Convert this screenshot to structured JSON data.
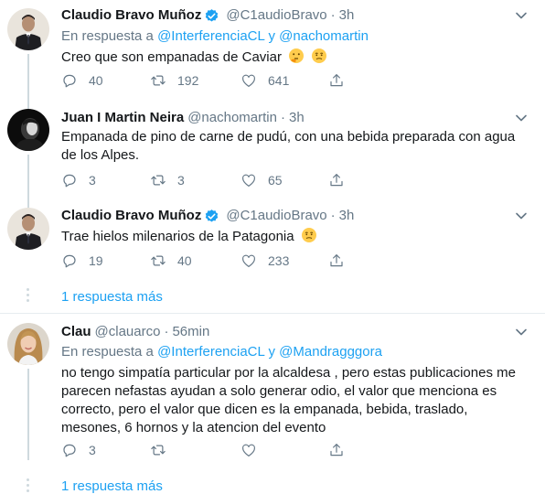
{
  "tweets": [
    {
      "name": "Claudio Bravo Muñoz",
      "verified": true,
      "handle": "@C1audioBravo",
      "time": "3h",
      "reply_prefix": "En respuesta a",
      "reply_to_1": "@InterferenciaCL",
      "reply_and": "y",
      "reply_to_2": "@nachomartin",
      "text": "Creo que son empanadas de Caviar",
      "emojis": [
        "thinking-face-emoji",
        "smirk-face-emoji"
      ],
      "replies": "40",
      "retweets": "192",
      "likes": "641"
    },
    {
      "name": "Juan I Martin Neira",
      "handle": "@nachomartin",
      "time": "3h",
      "text": "Empanada de pino de carne de pudú, con una bebida preparada con agua de los Alpes.",
      "replies": "3",
      "retweets": "3",
      "likes": "65"
    },
    {
      "name": "Claudio Bravo Muñoz",
      "verified": true,
      "handle": "@C1audioBravo",
      "time": "3h",
      "text": "Trae hielos milenarios de la Patagonia",
      "emojis": [
        "smirk-face-emoji"
      ],
      "replies": "19",
      "retweets": "40",
      "likes": "233"
    },
    {
      "name": "Clau",
      "handle": "@clauarco",
      "time": "56min",
      "reply_prefix": "En respuesta a",
      "reply_to_1": "@InterferenciaCL",
      "reply_and": "y",
      "reply_to_2": "@Mandragggora",
      "text": "no tengo simpatía particular por la alcaldesa , pero estas publicaciones me parecen nefastas ayudan a solo generar odio, el valor que menciona es correcto, pero el valor que dicen es  la empanada, bebida, traslado, mesones, 6 hornos y la atencion del evento",
      "replies": "3",
      "retweets": "",
      "likes": ""
    }
  ],
  "more_replies_1": "1 respuesta más",
  "more_replies_2": "1 respuesta más",
  "colors": {
    "accent": "#1da1f2",
    "secondary_text": "#657786",
    "thread_line": "#cfd9de",
    "divider": "#e6ecf0"
  }
}
